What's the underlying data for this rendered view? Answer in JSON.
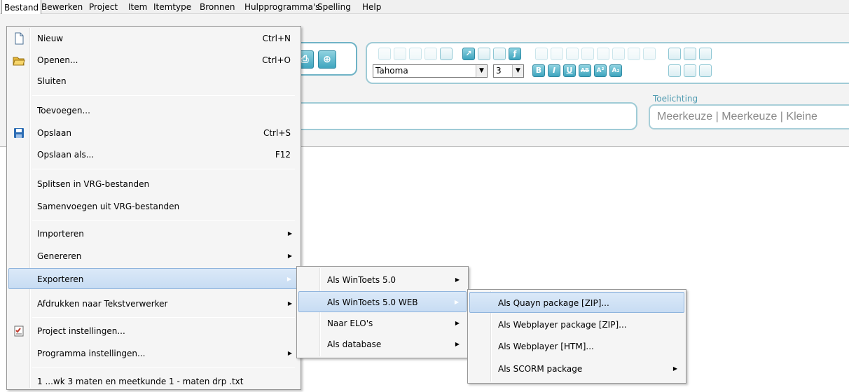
{
  "menubar": {
    "items": [
      {
        "label": "Bestand"
      },
      {
        "label": "Bewerken"
      },
      {
        "label": "Project"
      },
      {
        "label": "Item"
      },
      {
        "label": "Itemtype"
      },
      {
        "label": "Bronnen"
      },
      {
        "label": "Hulpprogramma's"
      },
      {
        "label": "Spelling"
      },
      {
        "label": "Help"
      }
    ]
  },
  "toolbar": {
    "font": "Tahoma",
    "size": "3",
    "bold": "B",
    "italic": "I",
    "underline": "U",
    "strike": "AB",
    "superscript": "A²",
    "subscript": "A₂",
    "toelichting_label": "Toelichting",
    "toelichting_value": "Meerkeuze | Meerkeuze | Kleine"
  },
  "bestand_menu": {
    "items": [
      {
        "label": "Nieuw",
        "shortcut": "Ctrl+N",
        "icon": "new-file-icon"
      },
      {
        "label": "Openen...",
        "shortcut": "Ctrl+O",
        "icon": "open-folder-icon"
      },
      {
        "label": "Sluiten",
        "shortcut": ""
      },
      {
        "label": "Toevoegen...",
        "shortcut": ""
      },
      {
        "label": "Opslaan",
        "shortcut": "Ctrl+S",
        "icon": "save-icon"
      },
      {
        "label": "Opslaan als...",
        "shortcut": "F12"
      },
      {
        "label": "Splitsen in VRG-bestanden",
        "shortcut": ""
      },
      {
        "label": "Samenvoegen uit VRG-bestanden",
        "shortcut": ""
      },
      {
        "label": "Importeren",
        "submenu": true
      },
      {
        "label": "Genereren",
        "submenu": true
      },
      {
        "label": "Exporteren",
        "submenu": true,
        "highlighted": true
      },
      {
        "label": "Afdrukken naar Tekstverwerker",
        "submenu": true
      },
      {
        "label": "Project instellingen...",
        "icon": "checklist-icon"
      },
      {
        "label": "Programma instellingen...",
        "submenu": true
      },
      {
        "label": "1 ...wk 3 maten en meetkunde 1 - maten drp .txt"
      }
    ]
  },
  "exporteren_menu": {
    "items": [
      {
        "label": "Als WinToets 5.0",
        "submenu": true
      },
      {
        "label": "Als WinToets 5.0 WEB",
        "submenu": true,
        "highlighted": true
      },
      {
        "label": "Naar ELO's",
        "submenu": true
      },
      {
        "label": "Als database",
        "submenu": true
      }
    ]
  },
  "web_menu": {
    "items": [
      {
        "label": "Als Quayn package [ZIP]...",
        "highlighted": true
      },
      {
        "label": "Als Webplayer package [ZIP]..."
      },
      {
        "label": "Als Webplayer [HTM]..."
      },
      {
        "label": "Als SCORM package",
        "submenu": true
      }
    ]
  },
  "colors": {
    "accent": "#3fa5bf",
    "highlight": "#c7dcf3",
    "menu_bg": "#f5f5f5"
  }
}
